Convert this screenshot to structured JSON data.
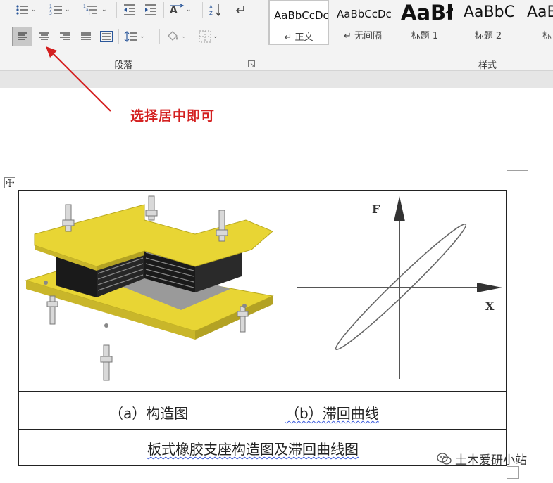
{
  "ribbon": {
    "paragraph_group_label": "段落",
    "styles_group_label": "样式",
    "styles": [
      {
        "preview": "AaBbCcDc",
        "name": "↵ 正文",
        "selected": true
      },
      {
        "preview": "AaBbCcDc",
        "name": "↵ 无间隔",
        "selected": false
      },
      {
        "preview": "AaBł",
        "name": "标题 1",
        "selected": false
      },
      {
        "preview": "AaBbC",
        "name": "标题 2",
        "selected": false
      },
      {
        "preview": "AaB",
        "name": "标",
        "selected": false
      }
    ]
  },
  "annotation": {
    "text": "选择居中即可",
    "color": "#d42020"
  },
  "table": {
    "caption_a": "（a）构造图",
    "caption_b": "（b）滞回曲线",
    "title": "板式橡胶支座构造图及滞回曲线图"
  },
  "figure_b": {
    "f_label": "F",
    "x_label": "X"
  },
  "watermark": {
    "text": "土木爱研小站"
  },
  "colors": {
    "accent_red": "#d42020",
    "plate_yellow": "#e8d534",
    "rubber_black": "#1a1a1a"
  }
}
